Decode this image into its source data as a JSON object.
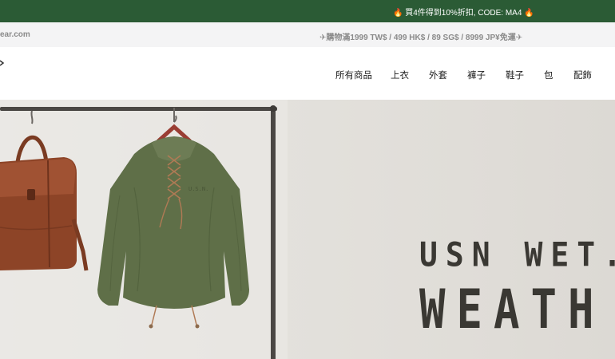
{
  "promo": {
    "icon_left": "flame-icon",
    "text": "買4件得到10%折扣, CODE: MA4",
    "icon_right": "flame-icon"
  },
  "info": {
    "site_url": "ear.com",
    "shipping": "✈購物滿1999 TW$ / 499 HK$ / 89 SG$ / 8999 JP¥免運✈"
  },
  "nav": {
    "items": [
      "所有商品",
      "上衣",
      "外套",
      "褲子",
      "鞋子",
      "包",
      "配飾"
    ]
  },
  "hero": {
    "line1": "USN WET.",
    "line2": "WEATH"
  },
  "colors": {
    "promo_bg": "#2b5b35",
    "info_bg": "#f4f4f5",
    "hero_text": "#3a3833"
  }
}
